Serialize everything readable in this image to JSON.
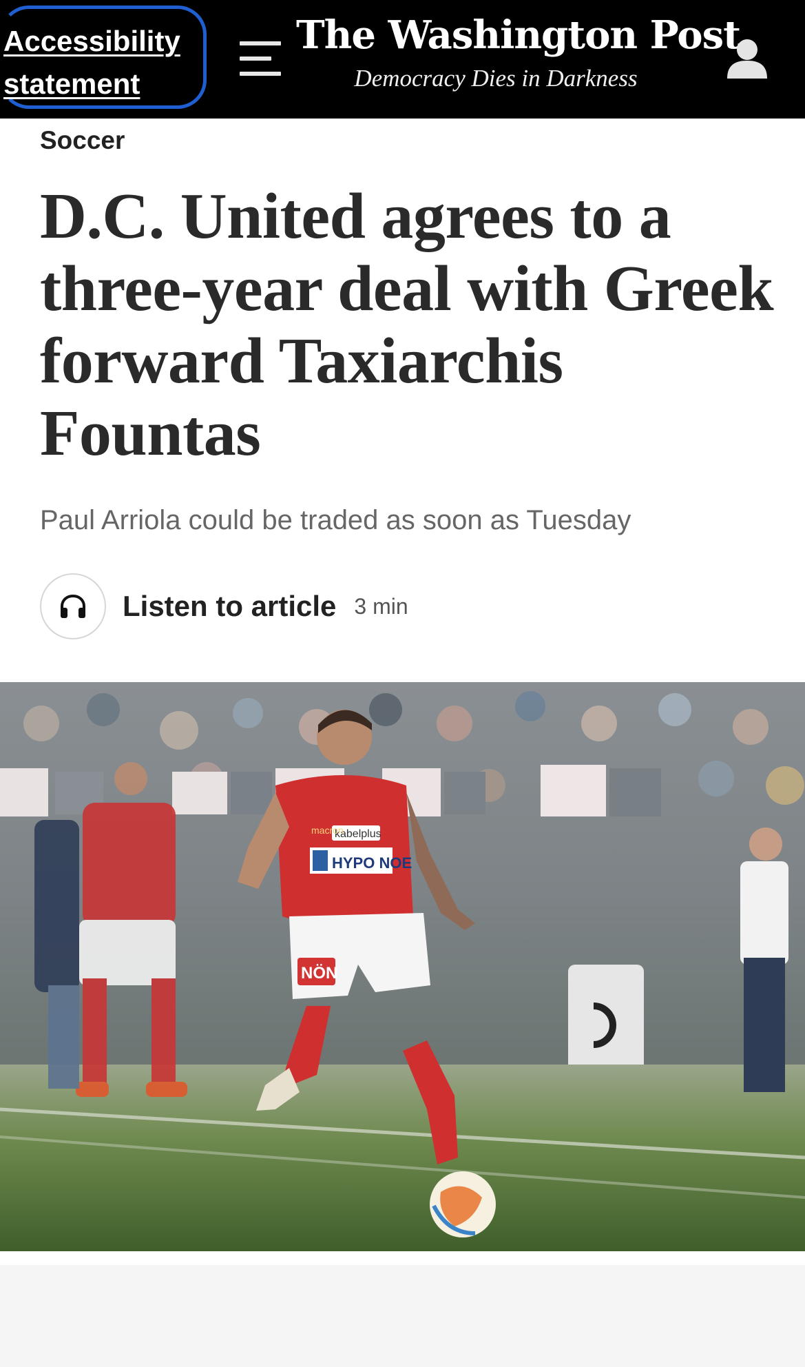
{
  "header": {
    "accessibility_line1": "Accessibility",
    "accessibility_line2": "statement",
    "logo": "The Washington Post",
    "tagline": "Democracy Dies in Darkness",
    "menu_icon": "hamburger-menu-icon",
    "user_icon": "user-account-icon"
  },
  "article": {
    "kicker": "Soccer",
    "headline": "D.C. United agrees to a three-year deal with Greek forward Taxiarchis Fountas",
    "dek": "Paul Arriola could be traded as soon as Tuesday",
    "listen": {
      "label": "Listen to article",
      "duration": "3 min",
      "icon": "headphones-icon"
    },
    "photo": {
      "jersey_sponsor": "HYPO NOE",
      "jersey_sponsor_top": "kabelplus",
      "jersey_brand": "macron",
      "shorts_text": "NÖN"
    }
  },
  "colors": {
    "header_bg": "#000000",
    "focus_ring": "#1f5fd1",
    "headline": "#2a2a2a",
    "dek": "#666666",
    "page_bottom": "#f5f5f5"
  }
}
